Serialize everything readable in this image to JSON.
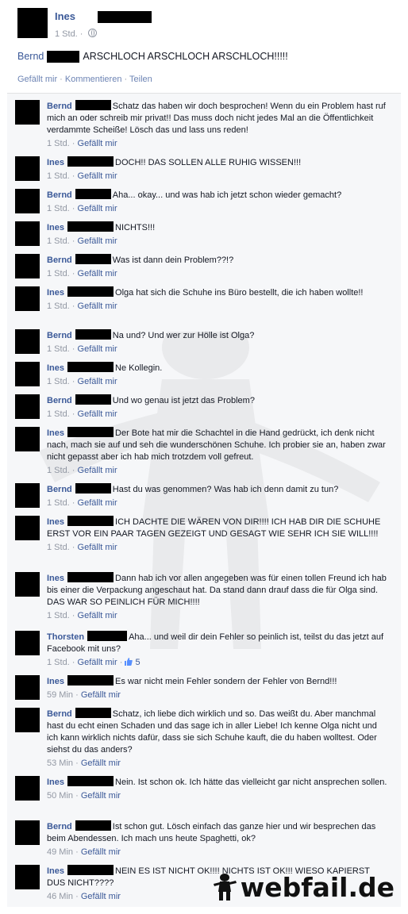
{
  "post": {
    "author": "Ines",
    "time": "1 Std.",
    "mention": "Bernd",
    "text": "ARSCHLOCH ARSCHLOCH ARSCHLOCH!!!!!",
    "actions": [
      "Gefällt mir",
      "Kommentieren",
      "Teilen"
    ]
  },
  "labels": {
    "like": "Gefällt mir"
  },
  "comments": [
    {
      "name": "Bernd",
      "text": "Schatz das haben wir doch besprochen! Wenn du ein Problem hast ruf mich an oder schreib mir privat!! Das muss doch nicht jedes Mal an die Öffentlichkeit verdammte Scheiße! Lösch das und lass uns reden!",
      "time": "1 Std."
    },
    {
      "name": "Ines",
      "text": "DOCH!! DAS SOLLEN ALLE RUHIG WISSEN!!!",
      "time": "1 Std."
    },
    {
      "name": "Bernd",
      "text": "Aha... okay... und was hab ich jetzt schon wieder gemacht?",
      "time": "1 Std."
    },
    {
      "name": "Ines",
      "text": "NICHTS!!!",
      "time": "1 Std."
    },
    {
      "name": "Bernd",
      "text": "Was ist dann dein Problem??!?",
      "time": "1 Std."
    },
    {
      "name": "Ines",
      "text": "Olga hat sich die Schuhe ins Büro bestellt, die ich haben wollte!!",
      "time": "1 Std."
    },
    {
      "name": "Bernd",
      "text": "Na und? Und wer zur Hölle ist Olga?",
      "time": "1 Std."
    },
    {
      "name": "Ines",
      "text": "Ne Kollegin.",
      "time": "1 Std."
    },
    {
      "name": "Bernd",
      "text": "Und wo genau ist jetzt das Problem?",
      "time": "1 Std."
    },
    {
      "name": "Ines",
      "text": "Der Bote hat mir die Schachtel in die Hand gedrückt, ich denk nicht nach, mach sie auf und seh die wunderschönen Schuhe. Ich probier sie an, haben zwar nicht gepasst aber ich hab mich trotzdem voll gefreut.",
      "time": "1 Std."
    },
    {
      "name": "Bernd",
      "text": "Hast du was genommen? Was hab ich denn damit zu tun?",
      "time": "1 Std."
    },
    {
      "name": "Ines",
      "text": "ICH DACHTE DIE WÄREN VON DIR!!!! ICH HAB DIR DIE SCHUHE ERST VOR EIN PAAR TAGEN GEZEIGT UND GESAGT WIE SEHR ICH SIE WILL!!!!",
      "time": "1 Std."
    },
    {
      "name": "Ines",
      "text": "Dann hab ich vor allen angegeben was für einen tollen Freund ich hab bis einer die Verpackung angeschaut hat. Da stand dann drauf dass die für Olga sind. DAS WAR SO PEINLICH FÜR MICH!!!!",
      "time": "1 Std."
    },
    {
      "name": "Thorsten",
      "text": "Aha... und weil dir dein Fehler so peinlich ist, teilst du das jetzt auf Facebook mit uns?",
      "time": "1 Std.",
      "likes": "5"
    },
    {
      "name": "Ines",
      "text": "Es war nicht mein Fehler sondern der Fehler von Bernd!!!",
      "time": "59 Min"
    },
    {
      "name": "Bernd",
      "text": "Schatz, ich liebe dich wirklich und so. Das weißt du. Aber manchmal hast du echt einen Schaden und das sage ich in aller Liebe! Ich kenne Olga nicht und ich kann wirklich nichts dafür, dass sie sich Schuhe kauft, die du haben wolltest. Oder siehst du das anders?",
      "time": "53 Min"
    },
    {
      "name": "Ines",
      "text": "Nein. Ist schon ok. Ich hätte das vielleicht gar nicht ansprechen sollen.",
      "time": "50 Min"
    },
    {
      "name": "Bernd",
      "text": "Ist schon gut. Lösch einfach das ganze hier und wir besprechen das beim Abendessen. Ich mach uns heute Spaghetti, ok?",
      "time": "49 Min"
    },
    {
      "name": "Ines",
      "text": "NEIN ES IST NICHT OK!!!! NICHTS IST OK!!! WIESO KAPIERST DUS NICHT????",
      "time": "46 Min"
    }
  ],
  "brand": "webfail.de"
}
